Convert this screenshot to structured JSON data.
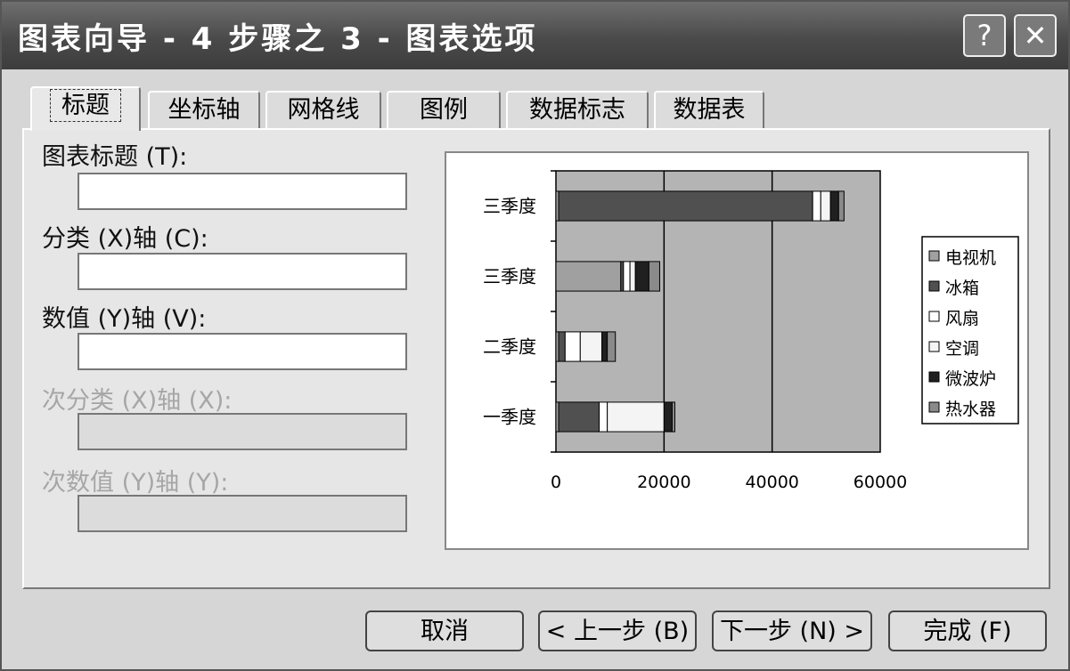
{
  "window": {
    "title": "图表向导 - 4 步骤之 3 - 图表选项",
    "help_label": "?",
    "close_label": "✕"
  },
  "tabs": [
    {
      "label": "标题",
      "active": true
    },
    {
      "label": "坐标轴"
    },
    {
      "label": "网格线"
    },
    {
      "label": "图例"
    },
    {
      "label": "数据标志"
    },
    {
      "label": "数据表"
    }
  ],
  "fields": [
    {
      "label": "图表标题 (T):",
      "value": "",
      "enabled": true
    },
    {
      "label": "分类 (X)轴 (C):",
      "value": "",
      "enabled": true
    },
    {
      "label": "数值 (Y)轴 (V):",
      "value": "",
      "enabled": true
    },
    {
      "label": "次分类 (X)轴 (X):",
      "value": "",
      "enabled": false
    },
    {
      "label": "次数值 (Y)轴 (Y):",
      "value": "",
      "enabled": false
    }
  ],
  "buttons": {
    "cancel": "取消",
    "back": "< 上一步 (B)",
    "next": "下一步 (N) >",
    "finish": "完成 (F)"
  },
  "chart_data": {
    "type": "bar",
    "orientation": "horizontal",
    "stacked": true,
    "categories": [
      "一季度",
      "二季度",
      "三季度",
      "三季度"
    ],
    "series": [
      {
        "name": "电视机",
        "values": [
          500,
          500,
          12000,
          500
        ],
        "color": "#a0a0a0"
      },
      {
        "name": "冰箱",
        "values": [
          7500,
          1200,
          500,
          47000
        ],
        "color": "#505050"
      },
      {
        "name": "风扇",
        "values": [
          1500,
          2800,
          1200,
          1500
        ],
        "color": "#ffffff"
      },
      {
        "name": "空调",
        "values": [
          10500,
          4000,
          1000,
          1800
        ],
        "color": "#f4f4f4"
      },
      {
        "name": "微波炉",
        "values": [
          1500,
          1000,
          2500,
          1500
        ],
        "color": "#202020"
      },
      {
        "name": "热水器",
        "values": [
          500,
          1500,
          2000,
          1000
        ],
        "color": "#8a8a8a"
      }
    ],
    "xlim": [
      0,
      60000
    ],
    "xticks": [
      0,
      20000,
      40000,
      60000
    ],
    "gridlines": true,
    "legend_position": "right",
    "plot_background": "#b4b4b4"
  }
}
